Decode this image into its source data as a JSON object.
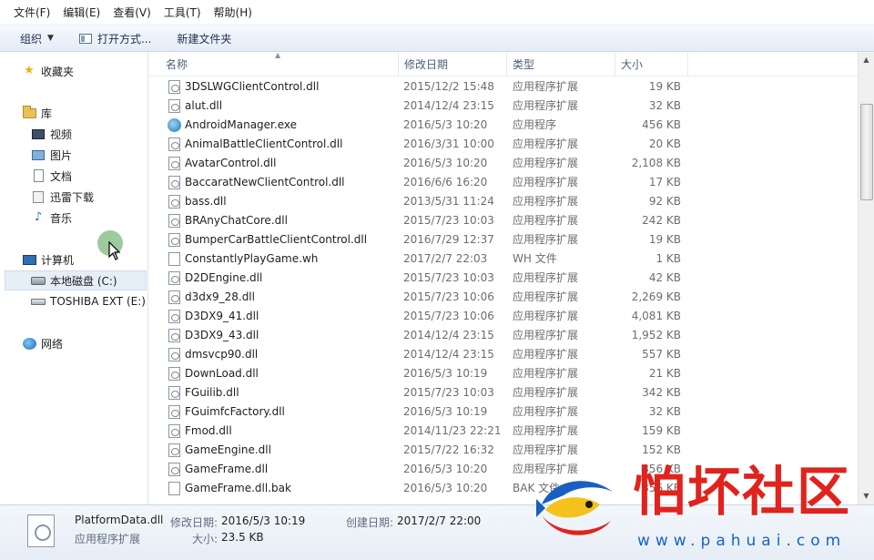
{
  "menubar": {
    "items": [
      "文件(F)",
      "编辑(E)",
      "查看(V)",
      "工具(T)",
      "帮助(H)"
    ]
  },
  "toolbar": {
    "organize_label": "组织",
    "open_with_label": "打开方式...",
    "new_folder_label": "新建文件夹"
  },
  "nav": {
    "favorites": "收藏夹",
    "libraries": "库",
    "videos": "视频",
    "pictures": "图片",
    "documents": "文档",
    "thunder_downloads": "迅雷下载",
    "music": "音乐",
    "computer": "计算机",
    "local_disk": "本地磁盘 (C:)",
    "toshiba": "TOSHIBA EXT (E:)",
    "network": "网络"
  },
  "columns": {
    "name": "名称",
    "date": "修改日期",
    "type": "类型",
    "size": "大小"
  },
  "files": [
    {
      "name": "3DSLWGClientControl.dll",
      "date": "2015/12/2 15:48",
      "type": "应用程序扩展",
      "size": "19 KB",
      "icon": "dll"
    },
    {
      "name": "alut.dll",
      "date": "2014/12/4 23:15",
      "type": "应用程序扩展",
      "size": "32 KB",
      "icon": "dll"
    },
    {
      "name": "AndroidManager.exe",
      "date": "2016/5/3 10:20",
      "type": "应用程序",
      "size": "456 KB",
      "icon": "exe"
    },
    {
      "name": "AnimalBattleClientControl.dll",
      "date": "2016/3/31 10:00",
      "type": "应用程序扩展",
      "size": "20 KB",
      "icon": "dll"
    },
    {
      "name": "AvatarControl.dll",
      "date": "2016/5/3 10:20",
      "type": "应用程序扩展",
      "size": "2,108 KB",
      "icon": "dll"
    },
    {
      "name": "BaccaratNewClientControl.dll",
      "date": "2016/6/6 16:20",
      "type": "应用程序扩展",
      "size": "17 KB",
      "icon": "dll"
    },
    {
      "name": "bass.dll",
      "date": "2013/5/31 11:24",
      "type": "应用程序扩展",
      "size": "92 KB",
      "icon": "dll"
    },
    {
      "name": "BRAnyChatCore.dll",
      "date": "2015/7/23 10:03",
      "type": "应用程序扩展",
      "size": "242 KB",
      "icon": "dll"
    },
    {
      "name": "BumperCarBattleClientControl.dll",
      "date": "2016/7/29 12:37",
      "type": "应用程序扩展",
      "size": "19 KB",
      "icon": "dll"
    },
    {
      "name": "ConstantlyPlayGame.wh",
      "date": "2017/2/7 22:03",
      "type": "WH 文件",
      "size": "1 KB",
      "icon": "file"
    },
    {
      "name": "D2DEngine.dll",
      "date": "2015/7/23 10:03",
      "type": "应用程序扩展",
      "size": "42 KB",
      "icon": "dll"
    },
    {
      "name": "d3dx9_28.dll",
      "date": "2015/7/23 10:06",
      "type": "应用程序扩展",
      "size": "2,269 KB",
      "icon": "dll"
    },
    {
      "name": "D3DX9_41.dll",
      "date": "2015/7/23 10:06",
      "type": "应用程序扩展",
      "size": "4,081 KB",
      "icon": "dll"
    },
    {
      "name": "D3DX9_43.dll",
      "date": "2014/12/4 23:15",
      "type": "应用程序扩展",
      "size": "1,952 KB",
      "icon": "dll"
    },
    {
      "name": "dmsvcp90.dll",
      "date": "2014/12/4 23:15",
      "type": "应用程序扩展",
      "size": "557 KB",
      "icon": "dll"
    },
    {
      "name": "DownLoad.dll",
      "date": "2016/5/3 10:19",
      "type": "应用程序扩展",
      "size": "21 KB",
      "icon": "dll"
    },
    {
      "name": "FGuilib.dll",
      "date": "2015/7/23 10:03",
      "type": "应用程序扩展",
      "size": "342 KB",
      "icon": "dll"
    },
    {
      "name": "FGuimfcFactory.dll",
      "date": "2016/5/3 10:19",
      "type": "应用程序扩展",
      "size": "32 KB",
      "icon": "dll"
    },
    {
      "name": "Fmod.dll",
      "date": "2014/11/23 22:21",
      "type": "应用程序扩展",
      "size": "159 KB",
      "icon": "dll"
    },
    {
      "name": "GameEngine.dll",
      "date": "2015/7/22 16:32",
      "type": "应用程序扩展",
      "size": "152 KB",
      "icon": "dll"
    },
    {
      "name": "GameFrame.dll",
      "date": "2016/5/3 10:20",
      "type": "应用程序扩展",
      "size": "856 KB",
      "icon": "dll"
    },
    {
      "name": "GameFrame.dll.bak",
      "date": "2016/5/3 10:20",
      "type": "BAK 文件",
      "size": "856 KB",
      "icon": "file"
    }
  ],
  "details": {
    "filename": "PlatformData.dll",
    "modified_label": "修改日期:",
    "modified_value": "2016/5/3 10:19",
    "created_label": "创建日期:",
    "created_value": "2017/2/7 22:00",
    "type_value": "应用程序扩展",
    "size_label": "大小:",
    "size_value": "23.5 KB"
  },
  "watermark": {
    "text": "怕坏社区",
    "url": "www.pahuai.com"
  }
}
